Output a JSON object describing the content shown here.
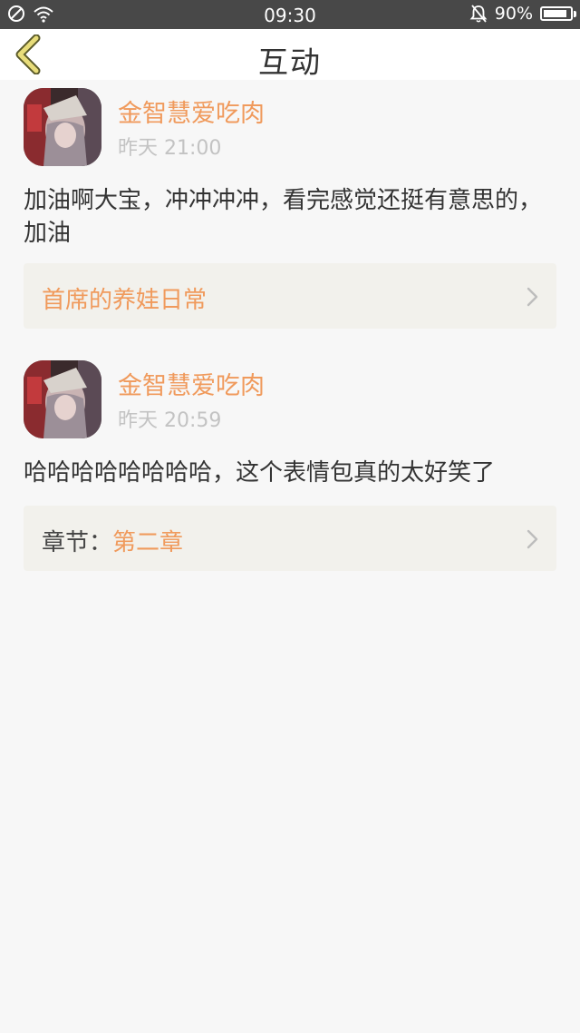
{
  "status_bar": {
    "time": "09:30",
    "battery": "90%",
    "battery_level": 0.9
  },
  "header": {
    "title": "互动"
  },
  "comments": [
    {
      "username": "金智慧爱吃肉",
      "time": "昨天 21:00",
      "text": "加油啊大宝，冲冲冲冲，看完感觉还挺有意思的，加油",
      "card": {
        "prefix": "",
        "value": "首席的养娃日常"
      }
    },
    {
      "username": "金智慧爱吃肉",
      "time": "昨天 20:59",
      "text": "哈哈哈哈哈哈哈哈，这个表情包真的太好笑了",
      "card": {
        "prefix": "章节：",
        "value": "第二章"
      }
    }
  ],
  "colors": {
    "accent": "#f09a5c",
    "status_bar": "#484848",
    "card_bg": "#f2f1ec",
    "back_icon": "#e8dd7a"
  },
  "icons": {
    "back": "chevron-left-icon",
    "card_arrow": "chevron-right-icon"
  }
}
